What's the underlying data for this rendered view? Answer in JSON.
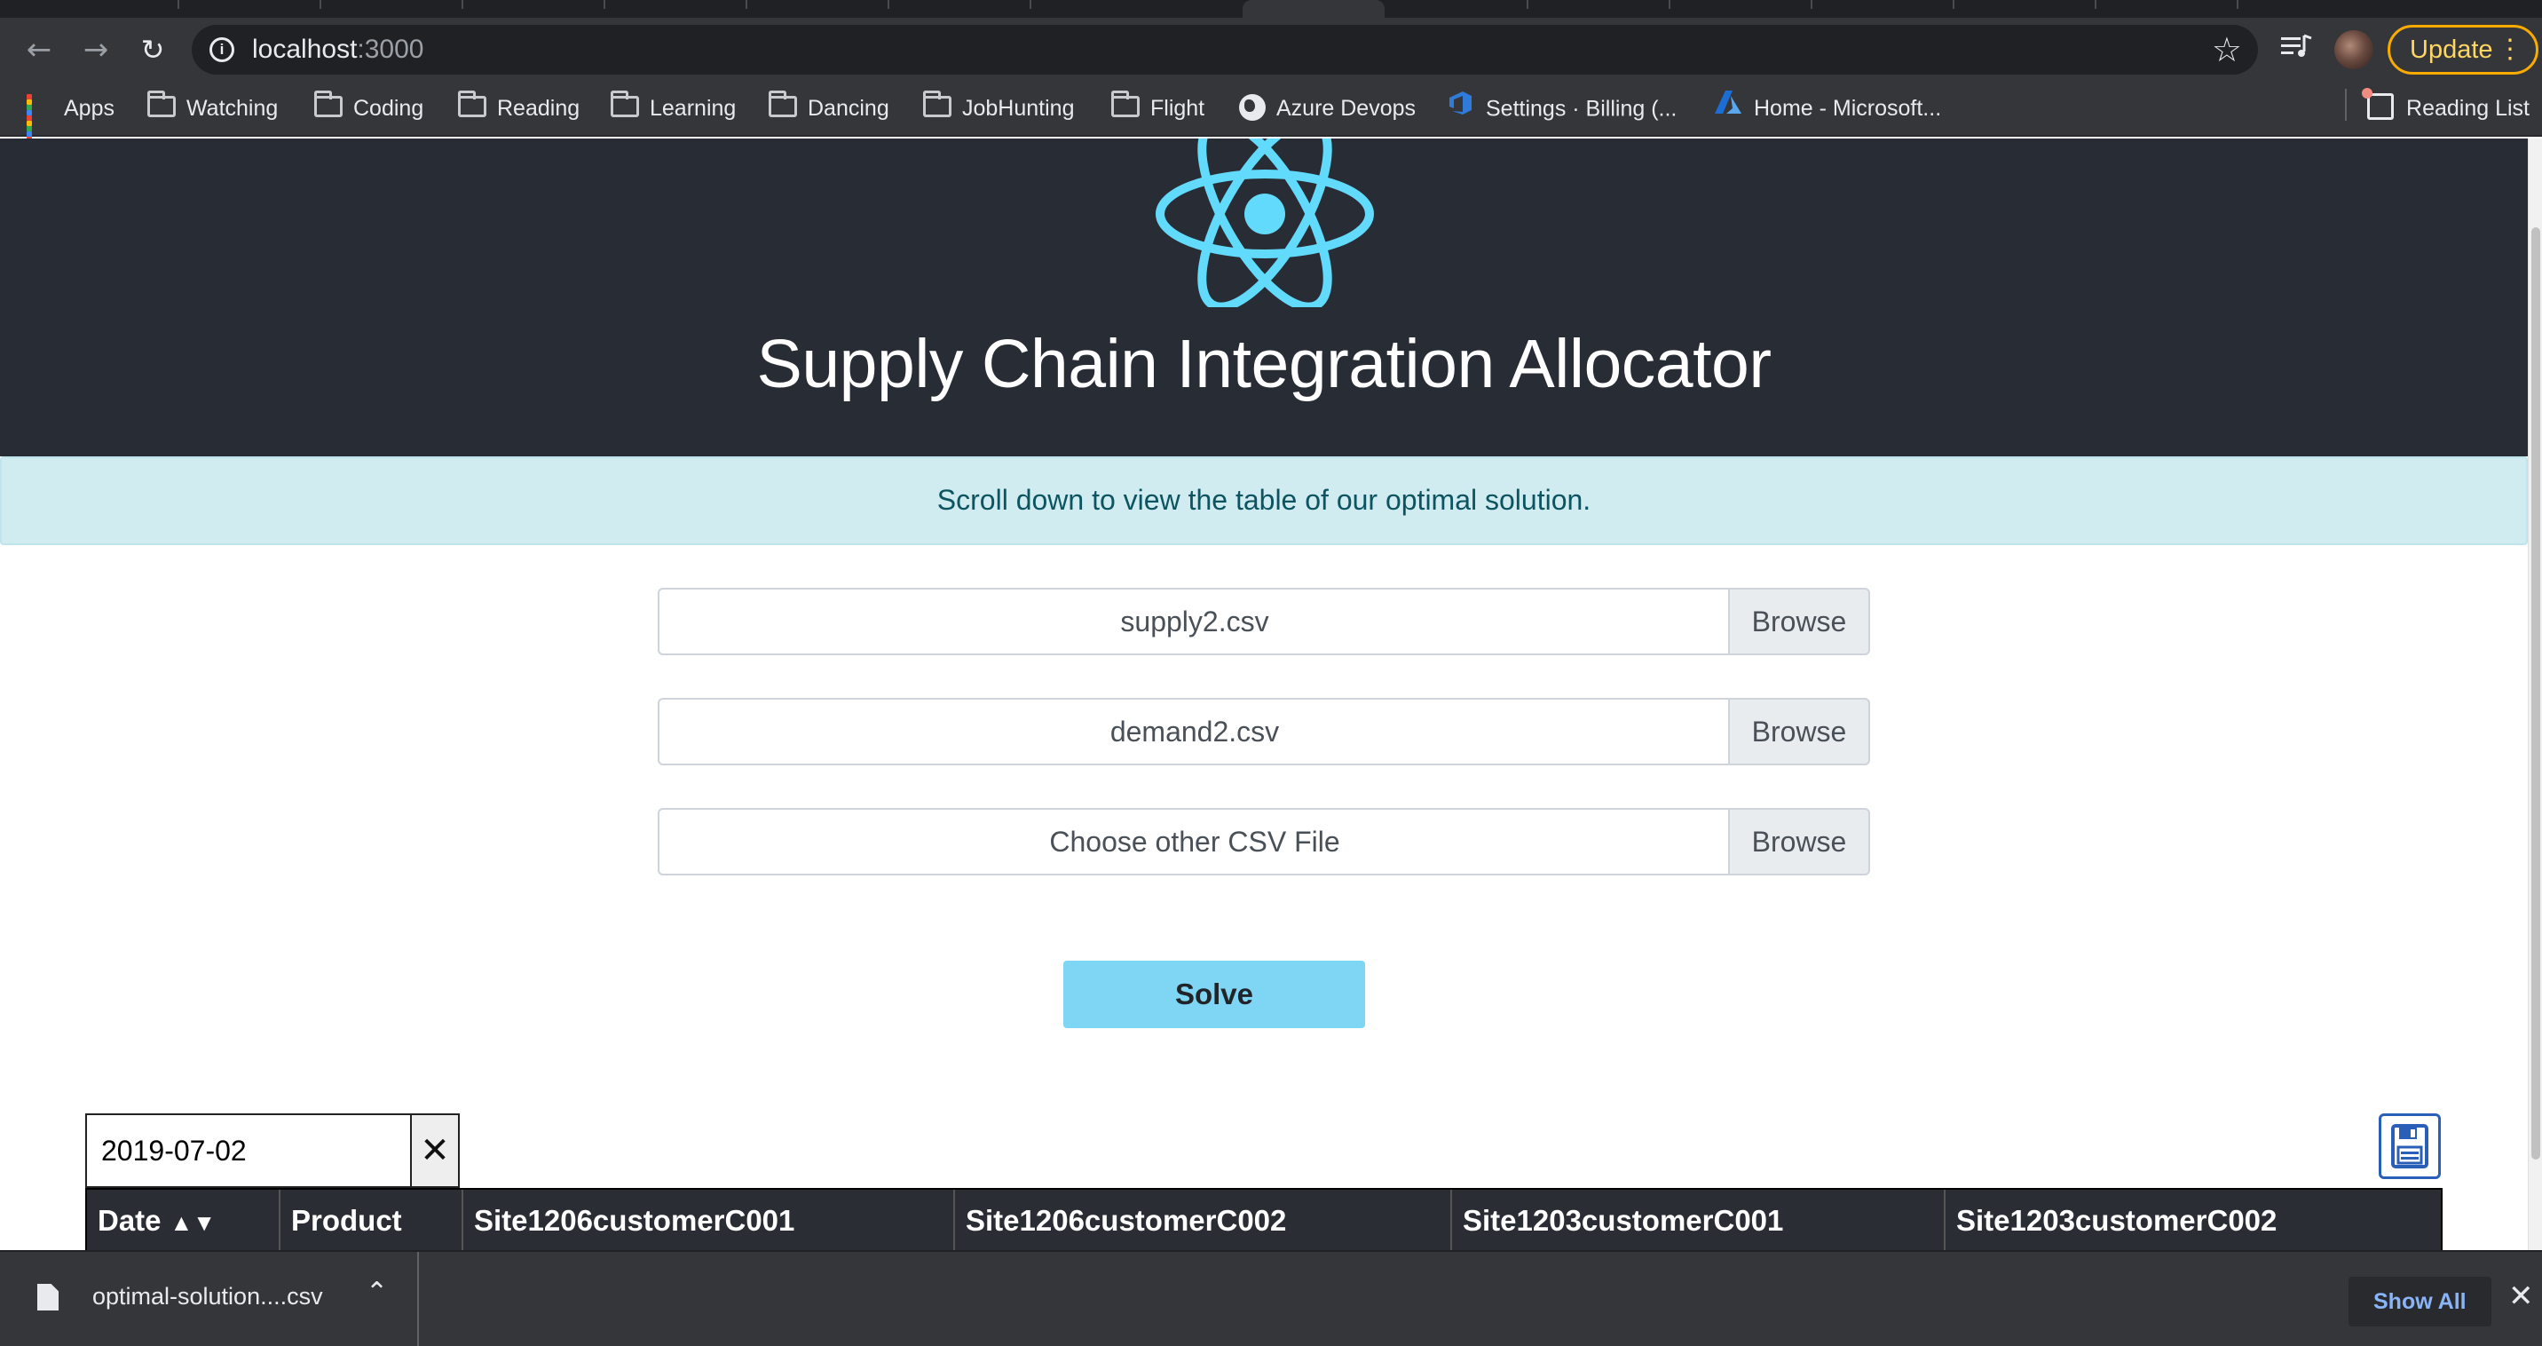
{
  "browser": {
    "url_host": "localhost",
    "url_port": ":3000",
    "update_label": "Update"
  },
  "bookmarks": {
    "items": [
      {
        "label": "Apps",
        "icon": "apps-grid-icon"
      },
      {
        "label": "Watching",
        "icon": "folder-icon"
      },
      {
        "label": "Coding",
        "icon": "folder-icon"
      },
      {
        "label": "Reading",
        "icon": "folder-icon"
      },
      {
        "label": "Learning",
        "icon": "folder-icon"
      },
      {
        "label": "Dancing",
        "icon": "folder-icon"
      },
      {
        "label": "JobHunting",
        "icon": "folder-icon"
      },
      {
        "label": "Flight",
        "icon": "folder-icon"
      },
      {
        "label": "Azure Devops",
        "icon": "globe-icon"
      },
      {
        "label": "Settings · Billing (...",
        "icon": "azure-devops-icon"
      },
      {
        "label": "Home - Microsoft...",
        "icon": "azure-icon"
      }
    ],
    "reading_list": "Reading List"
  },
  "app": {
    "title": "Supply Chain Integration Allocator",
    "alert": "Scroll down to view the table of our optimal solution.",
    "files": [
      {
        "label": "supply2.csv",
        "button": "Browse"
      },
      {
        "label": "demand2.csv",
        "button": "Browse"
      },
      {
        "label": "Choose other CSV File",
        "button": "Browse"
      }
    ],
    "solve_label": "Solve",
    "filter_value": "2019-07-02",
    "clear_symbol": "✕",
    "table": {
      "columns": [
        "Date",
        "Product",
        "Site1206customerC001",
        "Site1206customerC002",
        "Site1203customerC001",
        "Site1203customerC002"
      ],
      "sort_indicator": "▲▼"
    }
  },
  "downloads": {
    "file_name": "optimal-solution....csv",
    "show_all": "Show All"
  },
  "colors": {
    "react_logo": "#61dafb",
    "header_bg": "#282c34",
    "alert_bg": "#d1ecf1",
    "solve_bg": "#7fd6f4"
  }
}
